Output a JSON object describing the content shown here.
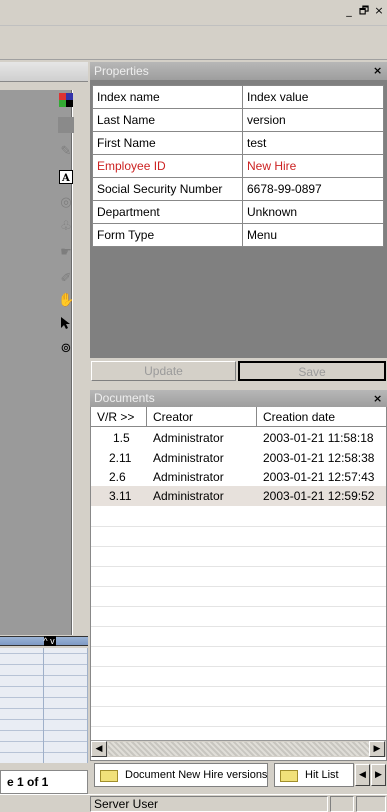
{
  "window": {
    "minimize_glyph": "_",
    "restore_glyph": "🗗",
    "close_glyph": "×"
  },
  "left_panel": {
    "page_indicator": "e 1 of 1",
    "tools": [
      "color-picker-icon",
      "gray-block-icon",
      "pencil-icon",
      "text-annotation-icon",
      "circle-icon",
      "stamp-icon",
      "hand-ink-icon",
      "pen-icon",
      "pan-hand-icon",
      "select-arrow-icon",
      "zoom-icon"
    ]
  },
  "properties": {
    "title": "Properties",
    "close_glyph": "×",
    "columns": [
      "Index name",
      "Index value"
    ],
    "rows": [
      {
        "name": "Last Name",
        "value": "version"
      },
      {
        "name": "First Name",
        "value": "test"
      },
      {
        "name": "Employee ID",
        "value": "New Hire"
      },
      {
        "name": "Social Security Number",
        "value": "6678-99-0897"
      },
      {
        "name": "Department",
        "value": "Unknown"
      },
      {
        "name": "Form Type",
        "value": "Menu"
      }
    ],
    "update_label": "Update",
    "save_label": "Save"
  },
  "documents": {
    "title": "Documents",
    "close_glyph": "×",
    "columns": [
      "V/R >>",
      "Creator",
      "Creation date"
    ],
    "rows": [
      {
        "version": "1.5",
        "creator": "Administrator",
        "date": "2003-01-21 11:58:18"
      },
      {
        "version": "2.11",
        "creator": "Administrator",
        "date": "2003-01-21 12:58:38"
      },
      {
        "version": "2.6",
        "creator": "Administrator",
        "date": "2003-01-21 12:57:43"
      },
      {
        "version": "3.11",
        "creator": "Administrator",
        "date": "2003-01-21 12:59:52"
      }
    ]
  },
  "tabs": [
    {
      "label": "Document New Hire versions"
    },
    {
      "label": "Hit List"
    }
  ],
  "status": {
    "user": "Server User"
  },
  "colors": {
    "highlight_red": "#cc2222",
    "panel_header": "#a8a8a8",
    "selected_row": "#e7e1dc"
  }
}
